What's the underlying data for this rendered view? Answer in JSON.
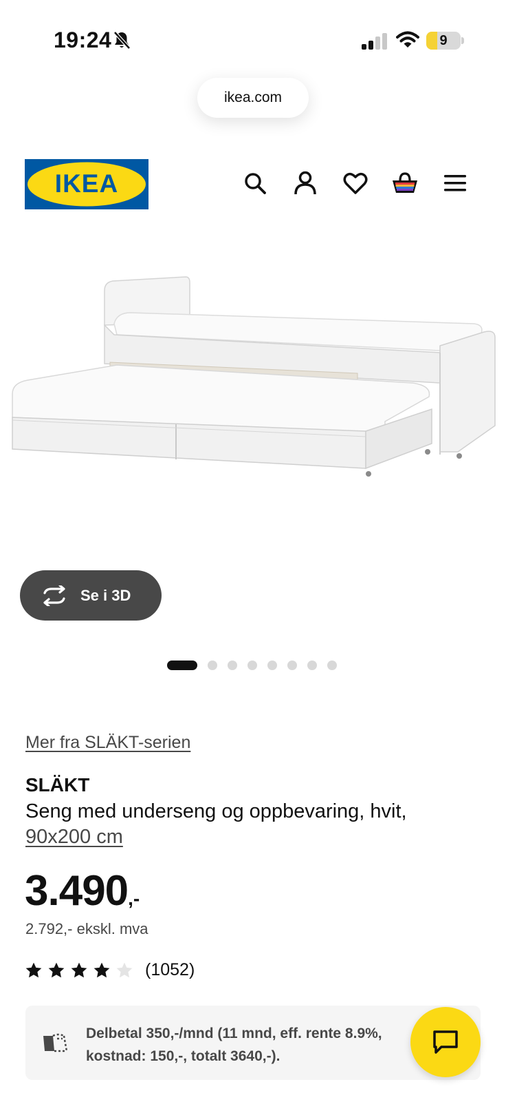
{
  "status_bar": {
    "time": "19:24",
    "battery_level": "9",
    "battery_fraction": 0.09,
    "icons": [
      "bell-slash-icon",
      "signal-icon",
      "wifi-icon",
      "battery-icon"
    ]
  },
  "browser": {
    "url": "ikea.com"
  },
  "header": {
    "logo_text": "IKEA",
    "nav_icons": [
      "search-icon",
      "account-icon",
      "heart-icon",
      "basket-icon",
      "menu-icon"
    ]
  },
  "gallery": {
    "view_3d_label": "Se i 3D",
    "total_images": 8,
    "active_index": 0
  },
  "product": {
    "series_link": "Mer fra SLÄKT-serien",
    "name": "SLÄKT",
    "description": "Seng med underseng og oppbevaring, hvit,",
    "size": "90x200 cm",
    "price_main": "3.490",
    "price_suffix": ",-",
    "price_ex_vat": "2.792,- ekskl. mva",
    "rating": 4,
    "rating_max": 5,
    "review_count": "(1052)"
  },
  "finance": {
    "line1": "Delbetal 350,-/mnd (11 mnd, eff. rente 8.9%,",
    "line2": "kostnad: 150,-, totalt 3640,-)."
  },
  "colors": {
    "ikea_blue": "#0058A3",
    "ikea_yellow": "#FBD914",
    "dark_button": "#484848"
  }
}
